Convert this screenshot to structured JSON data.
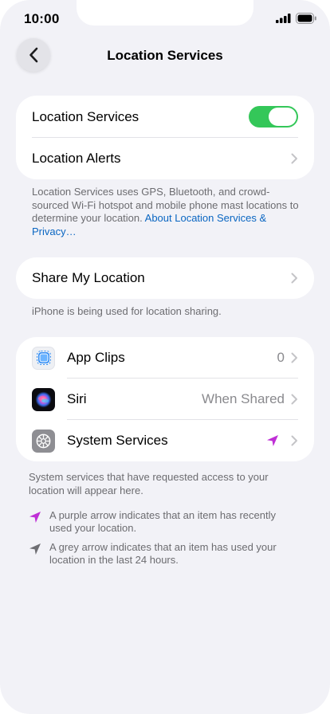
{
  "status_bar": {
    "time": "10:00"
  },
  "nav": {
    "title": "Location Services",
    "back_icon": "chevron-left-icon"
  },
  "location_group": {
    "services_label": "Location Services",
    "services_enabled": true,
    "alerts_label": "Location Alerts"
  },
  "location_footnote": {
    "text": "Location Services uses GPS, Bluetooth, and crowd-sourced Wi-Fi hotspot and mobile phone mast locations to determine your location.",
    "link": "About Location Services & Privacy…"
  },
  "share": {
    "label": "Share My Location",
    "footnote": "iPhone is being used for location sharing."
  },
  "apps": [
    {
      "label": "App Clips",
      "value": "0",
      "icon": "app-clips-icon"
    },
    {
      "label": "Siri",
      "value": "When Shared",
      "icon": "siri-icon"
    },
    {
      "label": "System Services",
      "value": "",
      "icon": "gear-icon",
      "indicator": "purple-location-arrow-icon"
    }
  ],
  "apps_footnote": "System services that have requested access to your location will appear here.",
  "legend": {
    "purple": "A purple arrow indicates that an item has recently used your location.",
    "grey": "A grey arrow indicates that an item has used your location in the last 24 hours."
  },
  "colors": {
    "accent": "#34c759",
    "link": "#0a66c2",
    "purple_arrow": "#bf2fd6",
    "grey_arrow": "#6e6e73",
    "background": "#f2f2f7"
  }
}
